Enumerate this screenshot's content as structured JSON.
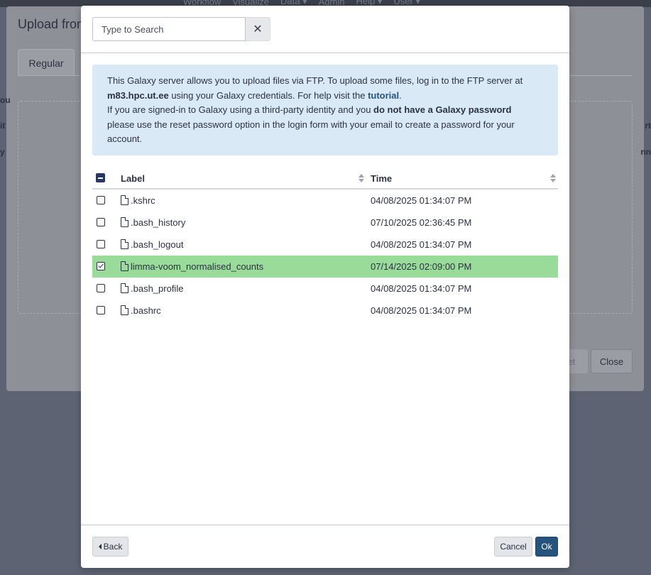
{
  "background": {
    "nav_items": [
      "Workflow",
      "Visualize",
      "Data ▾",
      "Admin",
      "Help ▾",
      "User ▾"
    ],
    "dialog_title": "Upload from",
    "tab_regular": "Regular",
    "left_edge_texts": [
      "ou",
      "it",
      "y"
    ],
    "right_edge_texts": [
      "rt",
      "nn"
    ],
    "reset_label": "et",
    "close_label": "Close"
  },
  "search": {
    "placeholder": "Type to Search",
    "clear_label": "✕"
  },
  "info": {
    "line1_a": "This Galaxy server allows you to upload files via FTP. To upload some files, log in to the FTP server at",
    "server": "m83.hpc.ut.ee",
    "line2_a": " using your Galaxy credentials. For help visit the ",
    "tutorial_link": "tutorial",
    "line2_b": ".",
    "line3_a": "If you are signed-in to Galaxy using a third-party identity and you ",
    "no_password": "do not have a Galaxy password",
    "line4": "please use the reset password option in the login form with your email to create a password for your account."
  },
  "table": {
    "col_label": "Label",
    "col_time": "Time",
    "rows": [
      {
        "name": ".kshrc",
        "time": "04/08/2025 01:34:07 PM",
        "selected": false
      },
      {
        "name": ".bash_history",
        "time": "07/10/2025 02:36:45 PM",
        "selected": false
      },
      {
        "name": ".bash_logout",
        "time": "04/08/2025 01:34:07 PM",
        "selected": false
      },
      {
        "name": "limma-voom_normalised_counts",
        "time": "07/14/2025 02:09:00 PM",
        "selected": true
      },
      {
        "name": ".bash_profile",
        "time": "04/08/2025 01:34:07 PM",
        "selected": false
      },
      {
        "name": ".bashrc",
        "time": "04/08/2025 01:34:07 PM",
        "selected": false
      }
    ]
  },
  "footer": {
    "back_label": "Back",
    "cancel_label": "Cancel",
    "ok_label": "Ok"
  },
  "colors": {
    "selected_row": "#99db99",
    "primary": "#25537b",
    "info_bg": "#d9eaf6"
  }
}
